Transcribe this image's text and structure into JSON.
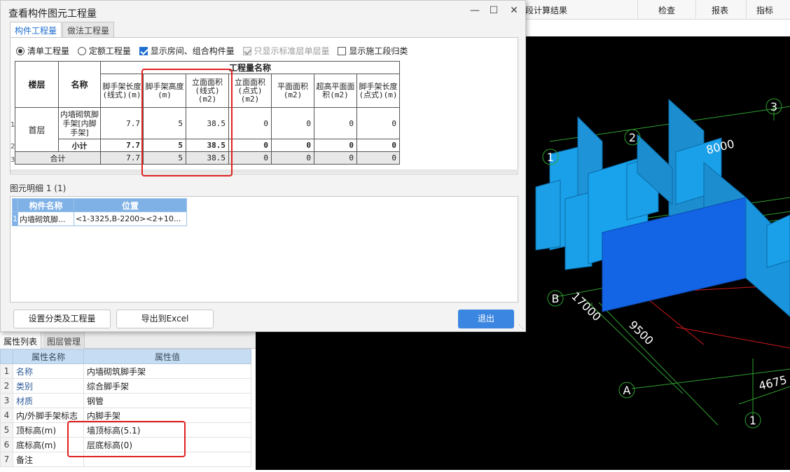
{
  "app": {
    "toolbar": {
      "partial_result": "段计算结果",
      "check": "检查",
      "report": "报表",
      "index": "指标"
    },
    "colors": {
      "canvas_bg": "#000000",
      "wall_blue": "#1aa0e8",
      "wall_highlight": "#1464e6",
      "grid_green": "#2fa02f",
      "axis_red": "#d01a1a"
    },
    "canvas": {
      "axis_labels": [
        "3",
        "2",
        "1",
        "B",
        "A",
        "1"
      ],
      "dimensions": [
        "8000",
        "17000",
        "9500",
        "4675"
      ]
    }
  },
  "left_panel": {
    "tabs": [
      "属性列表",
      "图层管理"
    ],
    "columns": [
      "属性名称",
      "属性值"
    ],
    "rows": [
      {
        "no": "1",
        "name": "名称",
        "value": "内墙砌筑脚手架"
      },
      {
        "no": "2",
        "name": "类别",
        "value": "综合脚手架"
      },
      {
        "no": "3",
        "name": "材质",
        "value": "钢管"
      },
      {
        "no": "4",
        "name": "内/外脚手架标志",
        "value": "内脚手架"
      },
      {
        "no": "5",
        "name": "顶标高(m)",
        "value": "墙顶标高(5.1)"
      },
      {
        "no": "6",
        "name": "底标高(m)",
        "value": "层底标高(0)"
      },
      {
        "no": "7",
        "name": "备注",
        "value": ""
      }
    ]
  },
  "dialog": {
    "title": "查看构件图元工程量",
    "tabs": [
      "构件工程量",
      "做法工程量"
    ],
    "options": {
      "list_qty": "清单工程量",
      "quota_qty": "定额工程量",
      "show_rooms": "显示房间、组合构件量",
      "std_floor_only": "只显示标准层单层量",
      "show_section": "显示施工段归类"
    },
    "table": {
      "col_floor": "楼层",
      "col_name": "名称",
      "group_header": "工程量名称",
      "sub_headers": [
        "脚手架长度(线式)(m)",
        "脚手架高度(m)",
        "立面面积(线式)(m2)",
        "立面面积(点式)(m2)",
        "平面面积(m2)",
        "超高平面面积(m2)",
        "脚手架长度(点式)(m)"
      ],
      "row_numbers": [
        "1",
        "2",
        "3"
      ],
      "floor": "首层",
      "item_name": "内墙砌筑脚手架[内脚手架]",
      "item_values": [
        "7.7",
        "5",
        "38.5",
        "0",
        "0",
        "0",
        "0"
      ],
      "subtotal_label": "小计",
      "subtotal_values": [
        "7.7",
        "5",
        "38.5",
        "0",
        "0",
        "0",
        "0"
      ],
      "total_label": "合计",
      "total_values": [
        "7.7",
        "5",
        "38.5",
        "0",
        "0",
        "0",
        "0"
      ]
    },
    "detail": {
      "label": "图元明细  1 (1)",
      "columns": [
        "构件名称",
        "位置"
      ],
      "rows": [
        {
          "no": "1",
          "name": "内墙砌筑脚...",
          "position": "<1-3325,B-2200><2+10..."
        }
      ]
    },
    "buttons": {
      "set_category": "设置分类及工程量",
      "export_excel": "导出到Excel",
      "exit": "退出"
    }
  }
}
